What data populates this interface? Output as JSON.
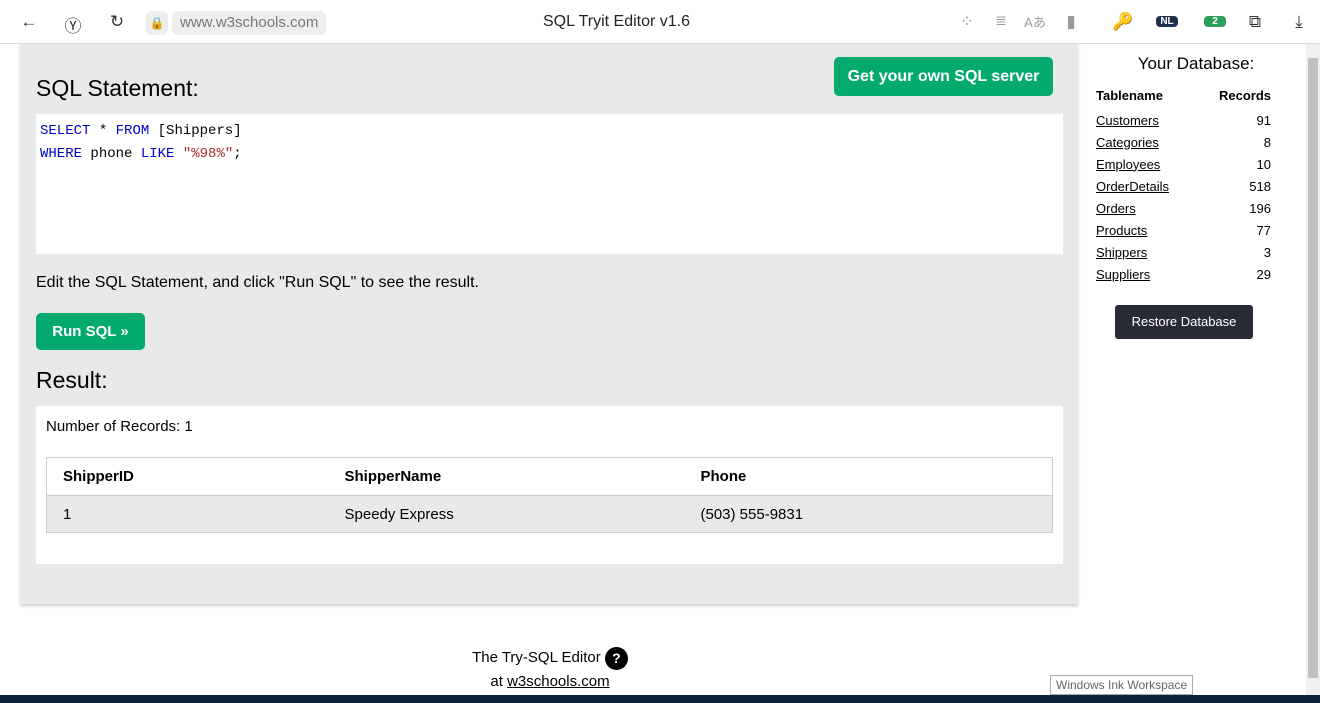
{
  "browser": {
    "url": "www.w3schools.com",
    "title": "SQL Tryit Editor v1.6",
    "extension_badges": {
      "nl": "NL",
      "count": "2"
    }
  },
  "main": {
    "heading": "SQL Statement:",
    "own_server_button": "Get your own SQL server",
    "code": {
      "l1_kw1": "SELECT",
      "l1_rest": " * ",
      "l1_kw2": "FROM",
      "l1_tbl": " [Shippers]",
      "l2_kw1": "WHERE",
      "l2_mid": " phone ",
      "l2_kw2": "LIKE",
      "l2_str": " \"%98%\"",
      "l2_end": ";"
    },
    "hint": "Edit the SQL Statement, and click \"Run SQL\" to see the result.",
    "run_button": "Run SQL »",
    "result_heading": "Result:",
    "record_count": "Number of Records: 1",
    "columns": [
      "ShipperID",
      "ShipperName",
      "Phone"
    ],
    "rows": [
      [
        "1",
        "Speedy Express",
        "(503) 555-9831"
      ]
    ]
  },
  "sidebar": {
    "title": "Your Database:",
    "headers": [
      "Tablename",
      "Records"
    ],
    "tables": [
      {
        "name": "Customers",
        "records": "91"
      },
      {
        "name": "Categories",
        "records": "8"
      },
      {
        "name": "Employees",
        "records": "10"
      },
      {
        "name": "OrderDetails",
        "records": "518"
      },
      {
        "name": "Orders",
        "records": "196"
      },
      {
        "name": "Products",
        "records": "77"
      },
      {
        "name": "Shippers",
        "records": "3"
      },
      {
        "name": "Suppliers",
        "records": "29"
      }
    ],
    "restore_button": "Restore Database"
  },
  "footer": {
    "line1": "The Try-SQL Editor",
    "help": "?",
    "at": "at ",
    "link": "w3schools.com"
  },
  "tooltip": "Windows Ink Workspace"
}
